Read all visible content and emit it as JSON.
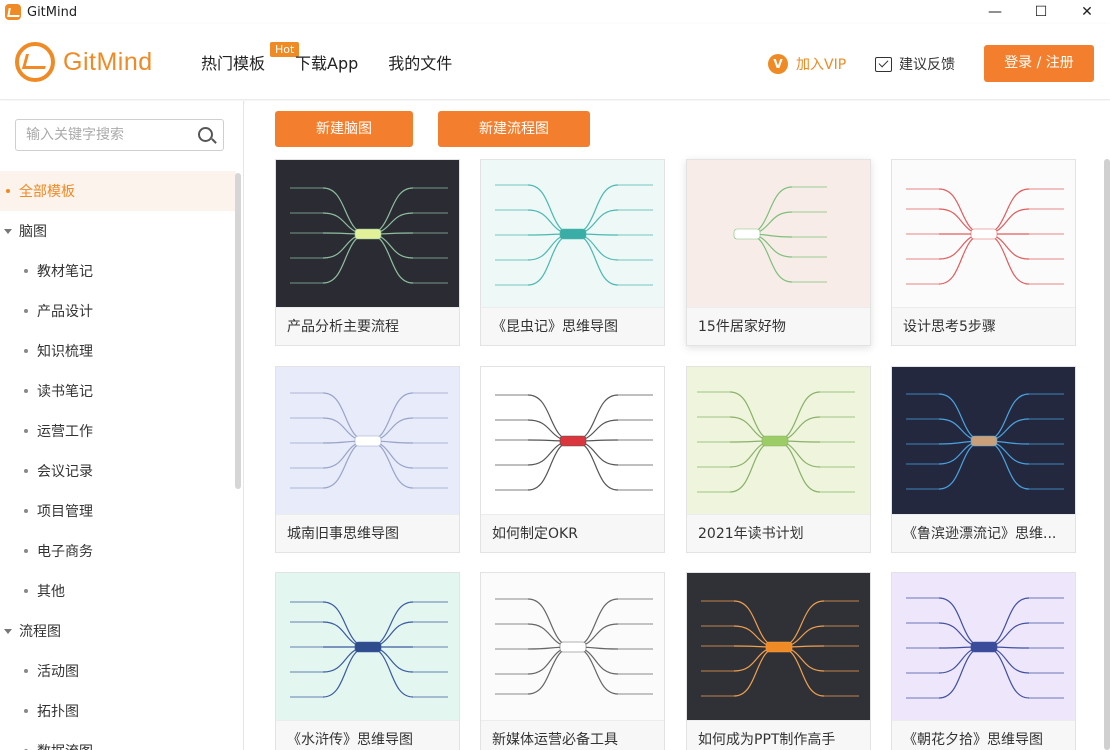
{
  "titlebar": {
    "title": "GitMind",
    "minimize": "—",
    "maximize": "☐",
    "close": "✕"
  },
  "header": {
    "logo_text": "GitMind",
    "nav": [
      {
        "label": "热门模板",
        "badge": "Hot"
      },
      {
        "label": "下载App"
      },
      {
        "label": "我的文件"
      }
    ],
    "vip_label": "加入VIP",
    "feedback_label": "建议反馈",
    "login_label": "登录 / 注册",
    "accent_color": "#f37f2e"
  },
  "sidebar": {
    "search_placeholder": "输入关键字搜索",
    "items": [
      {
        "label": "全部模板",
        "type": "top",
        "active": true
      },
      {
        "label": "脑图",
        "type": "group"
      },
      {
        "label": "教材笔记",
        "type": "sub"
      },
      {
        "label": "产品设计",
        "type": "sub"
      },
      {
        "label": "知识梳理",
        "type": "sub"
      },
      {
        "label": "读书笔记",
        "type": "sub"
      },
      {
        "label": "运营工作",
        "type": "sub"
      },
      {
        "label": "会议记录",
        "type": "sub"
      },
      {
        "label": "项目管理",
        "type": "sub"
      },
      {
        "label": "电子商务",
        "type": "sub"
      },
      {
        "label": "其他",
        "type": "sub"
      },
      {
        "label": "流程图",
        "type": "group"
      },
      {
        "label": "活动图",
        "type": "sub"
      },
      {
        "label": "拓扑图",
        "type": "sub"
      },
      {
        "label": "数据流图",
        "type": "sub"
      }
    ]
  },
  "main": {
    "new_mindmap_label": "新建脑图",
    "new_flowchart_label": "新建流程图",
    "templates": [
      {
        "title": "产品分析主要流程",
        "bg": "#2b2b33",
        "line": "#8fc0a0",
        "center": "#e3f09a"
      },
      {
        "title": "《昆虫记》思维导图",
        "bg": "#eef8f7",
        "line": "#4bb8b0",
        "center": "#3aaea6"
      },
      {
        "title": "15件居家好物",
        "bg": "#f8ece8",
        "line": "#7cc07a",
        "center": "#ffffff"
      },
      {
        "title": "设计思考5步骤",
        "bg": "#fbfbfb",
        "line": "#e05c5c",
        "center": "#ffffff"
      },
      {
        "title": "城南旧事思维导图",
        "bg": "#e8ebfa",
        "line": "#9aa4c8",
        "center": "#ffffff"
      },
      {
        "title": "如何制定OKR",
        "bg": "#ffffff",
        "line": "#555555",
        "center": "#d9363e"
      },
      {
        "title": "2021年读书计划",
        "bg": "#eef5dc",
        "line": "#8ab06a",
        "center": "#9ccc65"
      },
      {
        "title": "《鲁滨逊漂流记》思维...",
        "bg": "#23283f",
        "line": "#4aa3e0",
        "center": "#c9a07a"
      },
      {
        "title": "《水浒传》思维导图",
        "bg": "#e4f6f0",
        "line": "#3a5aa0",
        "center": "#2f4d8c"
      },
      {
        "title": "新媒体运营必备工具",
        "bg": "#fbfbfb",
        "line": "#666666",
        "center": "#ffffff"
      },
      {
        "title": "如何成为PPT制作高手",
        "bg": "#2f3136",
        "line": "#f0a050",
        "center": "#f08a24"
      },
      {
        "title": "《朝花夕拾》思维导图",
        "bg": "#eee6fb",
        "line": "#4050a0",
        "center": "#3a4c9a"
      }
    ]
  }
}
